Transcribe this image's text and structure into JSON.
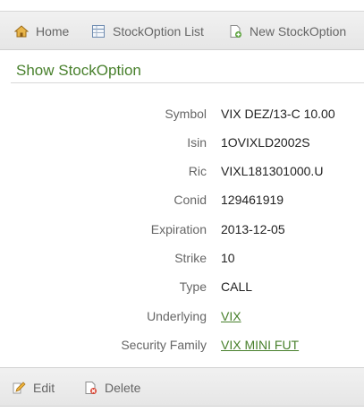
{
  "nav": {
    "home_label": "Home",
    "list_label": "StockOption List",
    "new_label": "New StockOption"
  },
  "page_title": "Show StockOption",
  "fields": [
    {
      "label": "Symbol",
      "value": "VIX DEZ/13-C 10.00"
    },
    {
      "label": "Isin",
      "value": "1OVIXLD2002S"
    },
    {
      "label": "Ric",
      "value": "VIXL181301000.U"
    },
    {
      "label": "Conid",
      "value": "129461919"
    },
    {
      "label": "Expiration",
      "value": "2013-12-05"
    },
    {
      "label": "Strike",
      "value": "10"
    },
    {
      "label": "Type",
      "value": "CALL"
    },
    {
      "label": "Underlying",
      "value": "VIX"
    },
    {
      "label": "Security Family",
      "value": "VIX MINI FUT"
    }
  ],
  "actions": {
    "edit_label": "Edit",
    "delete_label": "Delete"
  },
  "colors": {
    "accent": "#48802c",
    "bar": "#ececec",
    "muted_text": "#666666"
  }
}
